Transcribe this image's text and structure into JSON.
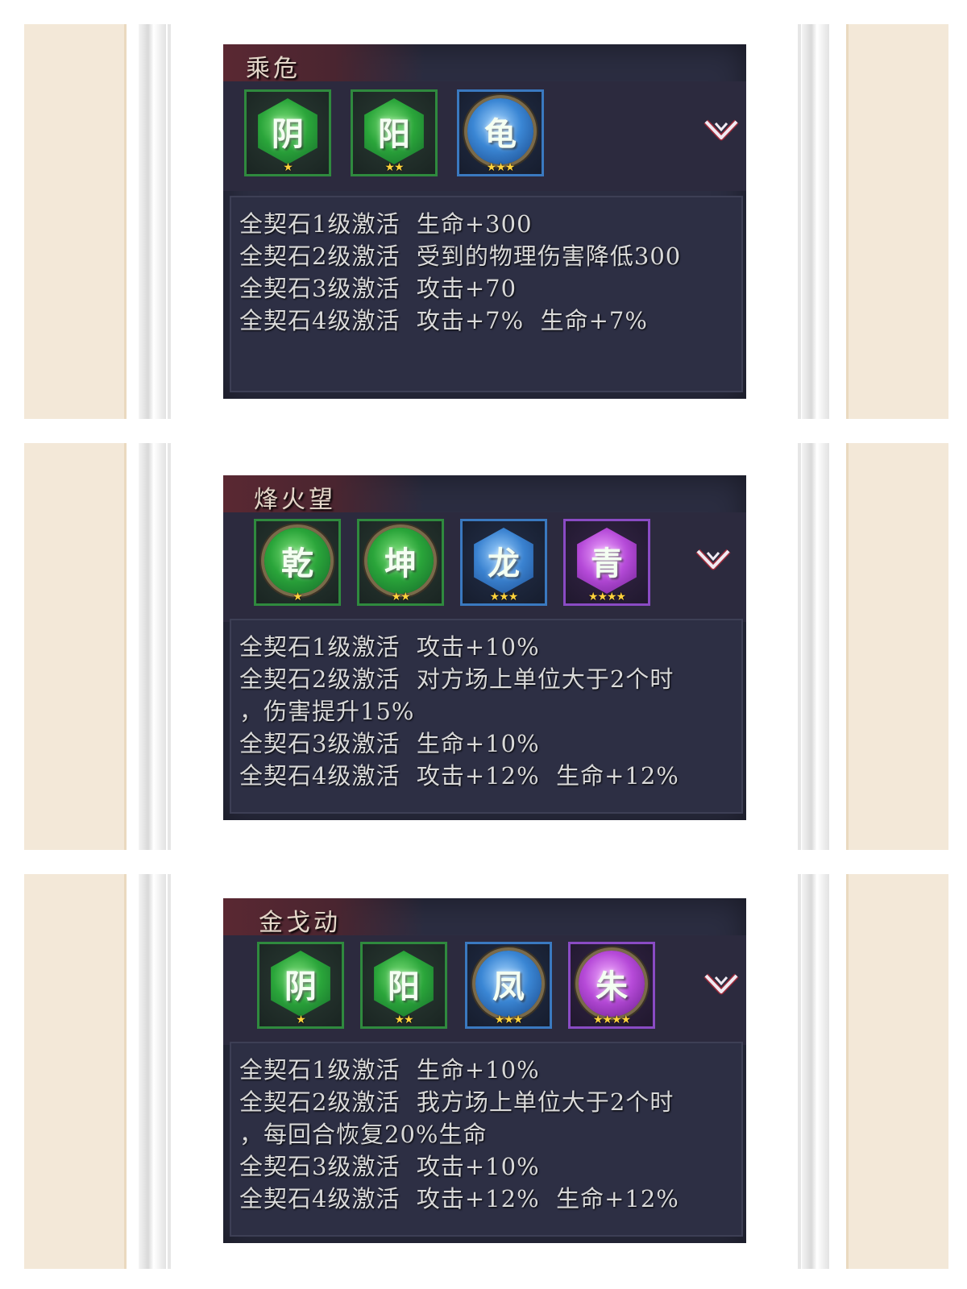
{
  "panels": [
    {
      "title": "乘危",
      "icons": [
        {
          "char": "阴",
          "shape": "hex",
          "color": "green",
          "stars": "★"
        },
        {
          "char": "阳",
          "shape": "hex",
          "color": "green",
          "stars": "★★"
        },
        {
          "char": "龟",
          "shape": "round",
          "color": "blue",
          "stars": "★★★"
        }
      ],
      "lines": [
        "全契石1级激活  生命+300",
        "全契石2级激活  受到的物理伤害降低300",
        "全契石3级激活  攻击+70",
        "全契石4级激活  攻击+7%  生命+7%"
      ]
    },
    {
      "title": "烽火望",
      "icons": [
        {
          "char": "乾",
          "shape": "round",
          "color": "green",
          "stars": "★"
        },
        {
          "char": "坤",
          "shape": "round",
          "color": "green",
          "stars": "★★"
        },
        {
          "char": "龙",
          "shape": "hex",
          "color": "blue",
          "stars": "★★★"
        },
        {
          "char": "青",
          "shape": "hex",
          "color": "purple",
          "stars": "★★★★"
        }
      ],
      "lines": [
        "全契石1级激活  攻击+10%",
        "全契石2级激活  对方场上单位大于2个时",
        "，伤害提升15%",
        "全契石3级激活  生命+10%",
        "全契石4级激活  攻击+12%  生命+12%"
      ]
    },
    {
      "title": "金戈动",
      "icons": [
        {
          "char": "阴",
          "shape": "hex",
          "color": "green",
          "stars": "★"
        },
        {
          "char": "阳",
          "shape": "hex",
          "color": "green",
          "stars": "★★"
        },
        {
          "char": "凤",
          "shape": "round",
          "color": "blue",
          "stars": "★★★"
        },
        {
          "char": "朱",
          "shape": "round",
          "color": "purple",
          "stars": "★★★★"
        }
      ],
      "lines": [
        "全契石1级激活  生命+10%",
        "全契石2级激活  我方场上单位大于2个时",
        "，每回合恢复20%生命",
        "全契石3级激活  攻击+10%",
        "全契石4级激活  攻击+12%  生命+12%"
      ]
    }
  ],
  "colors": {
    "panel_bg": "#2b2d41",
    "text": "#d9d9d9",
    "title": "#e4d7c9",
    "cream": "#f3e8d8",
    "chevron": "#f0eaf2"
  },
  "chevron_icon": "expand-chevron-icon"
}
